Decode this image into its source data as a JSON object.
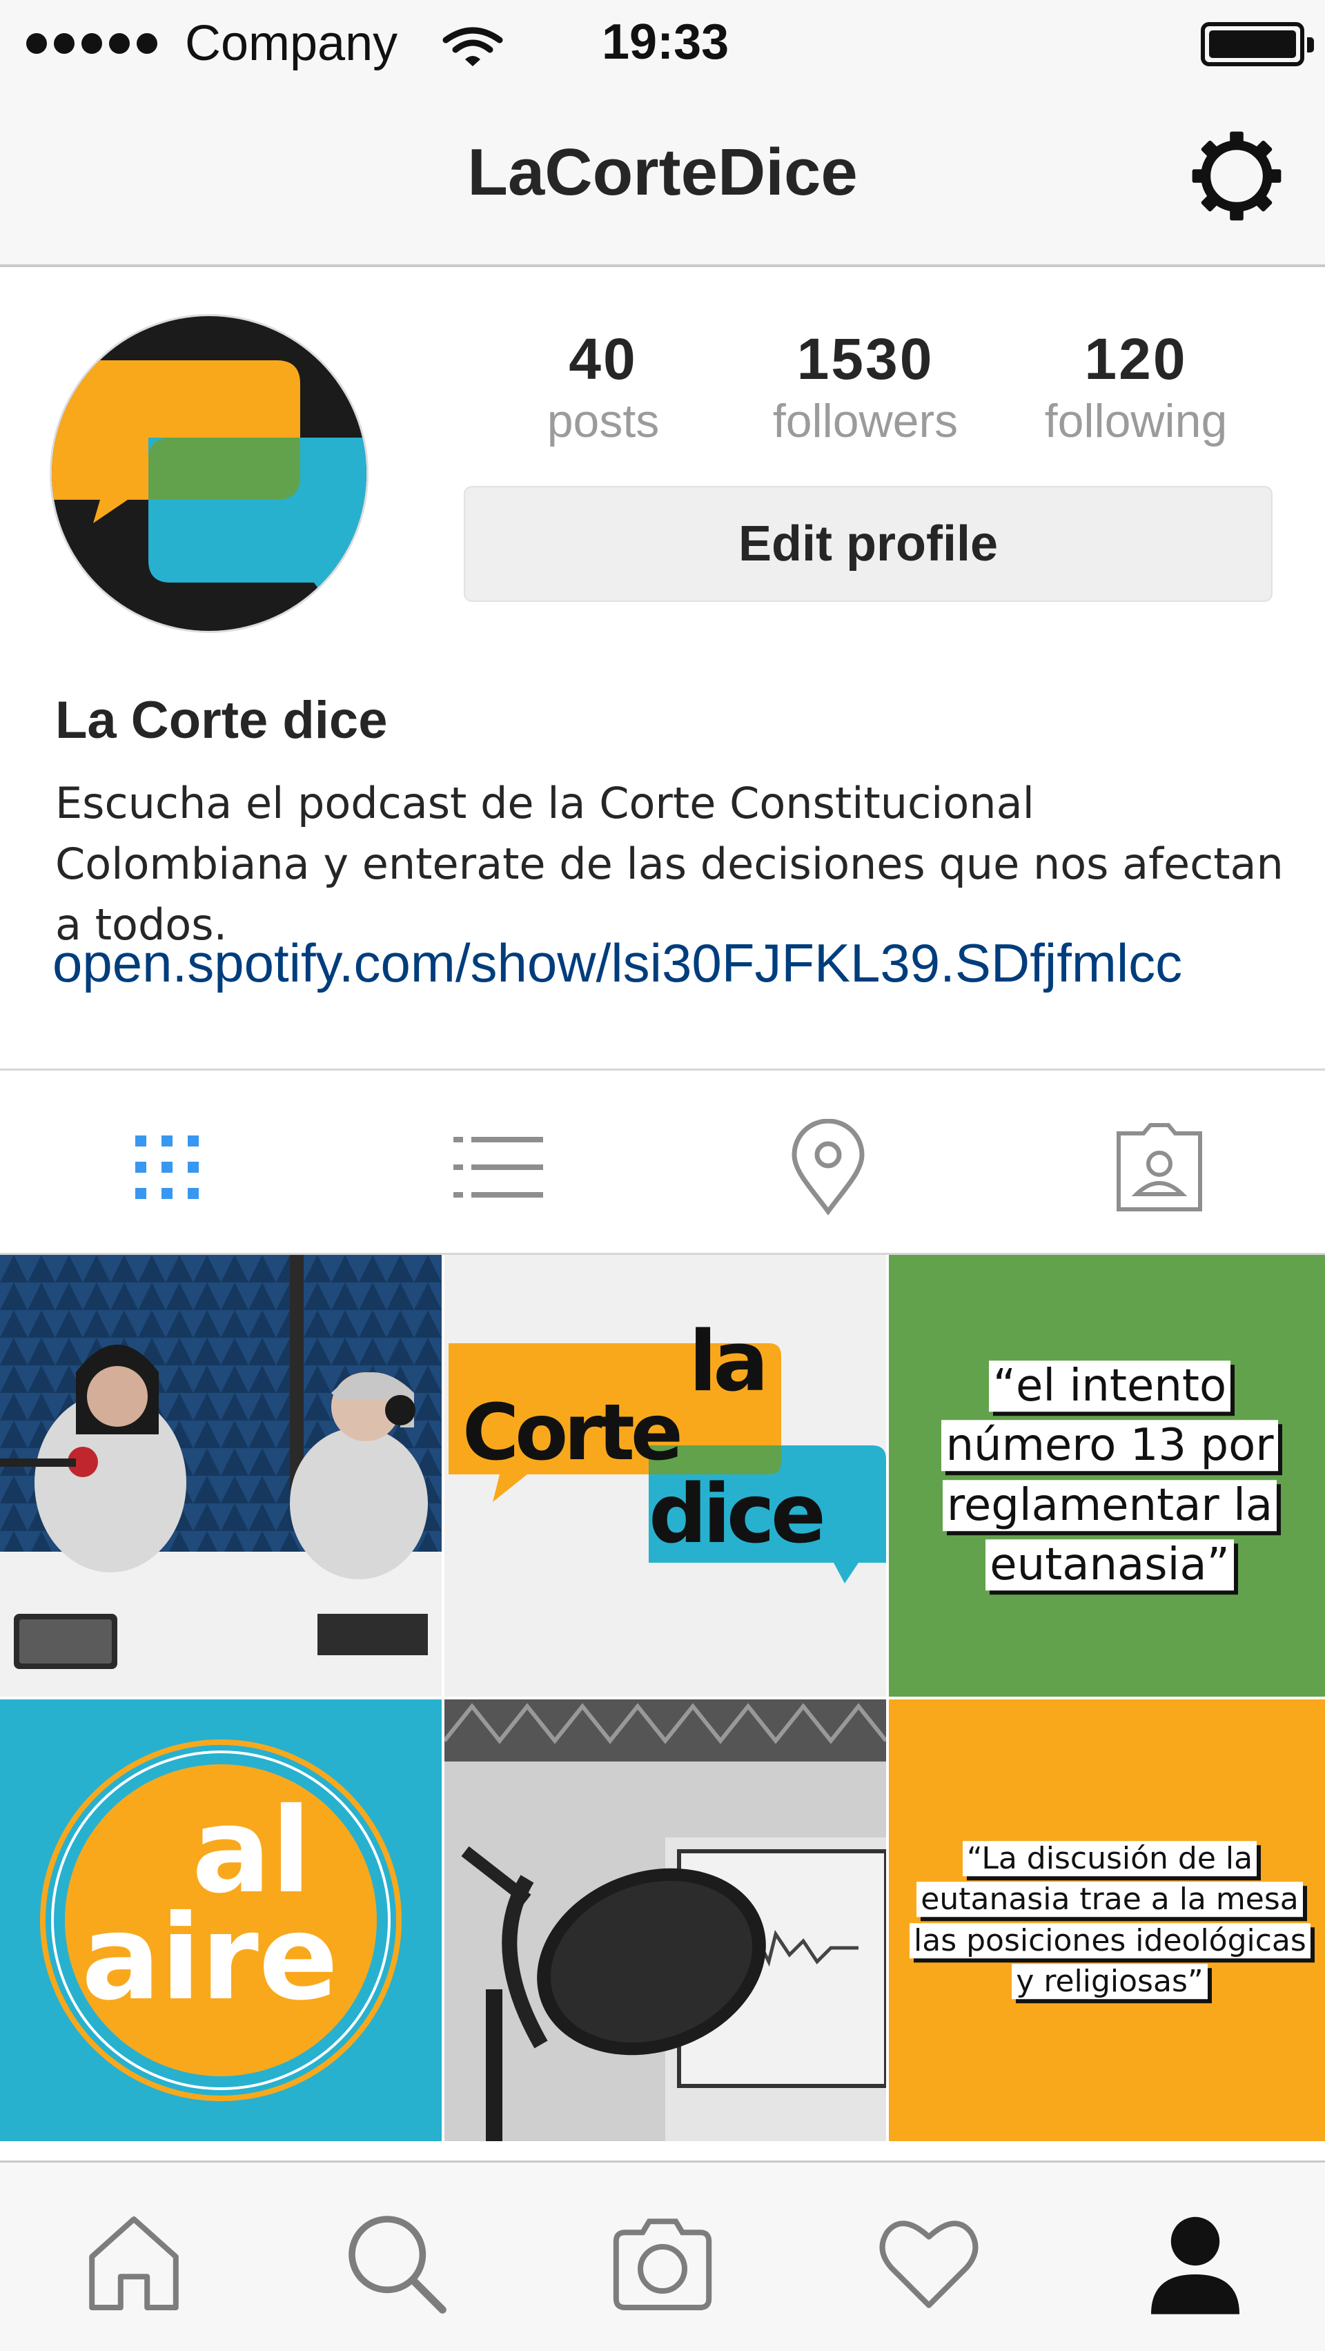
{
  "status_bar": {
    "carrier": "Company",
    "time": "19:33"
  },
  "header": {
    "title": "LaCorteDice",
    "settings_icon": "gear-icon"
  },
  "profile": {
    "stats": [
      {
        "value": "40",
        "label": "posts"
      },
      {
        "value": "1530",
        "label": "followers"
      },
      {
        "value": "120",
        "label": "following"
      }
    ],
    "edit_button": "Edit profile",
    "name": "La Corte dice",
    "bio": "Escucha el podcast de la Corte Constitucional Colombiana y enterate de las decisiones que nos afectan a todos.",
    "link": "open.spotify.com/show/lsi30FJFKL39.SDfjfmlcc"
  },
  "tabs": [
    {
      "icon": "grid-icon",
      "active": true
    },
    {
      "icon": "list-icon",
      "active": false
    },
    {
      "icon": "location-pin-icon",
      "active": false
    },
    {
      "icon": "tagged-user-icon",
      "active": false
    }
  ],
  "posts": {
    "logo_post": {
      "line1": "la",
      "line2": "Corte",
      "line3": "dice"
    },
    "quote_1": "“el intento número 13 por reglamentar la eutanasia”",
    "al_aire": {
      "line1": "al",
      "line2": "aire"
    },
    "quote_2": "“La discusión de la eutanasia trae a la mesa las posiciones ideológicas y religiosas”"
  },
  "bottom_nav": [
    {
      "icon": "home-icon"
    },
    {
      "icon": "search-icon"
    },
    {
      "icon": "camera-icon"
    },
    {
      "icon": "heart-icon"
    },
    {
      "icon": "profile-icon"
    }
  ],
  "colors": {
    "brand_orange": "#f9a81c",
    "brand_blue": "#27b1cf",
    "brand_green": "#62a24c",
    "active_tab_blue": "#3897f0",
    "link_blue": "#003d7c"
  }
}
